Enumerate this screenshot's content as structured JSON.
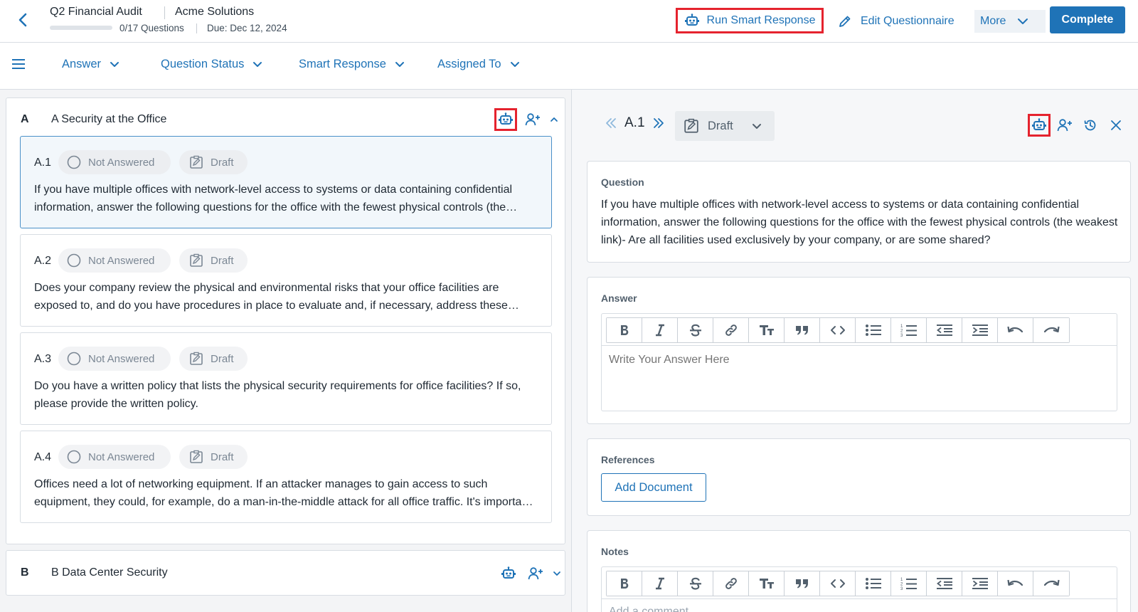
{
  "header": {
    "title": "Q2 Financial Audit",
    "company": "Acme Solutions",
    "questions_progress": "0/17 Questions",
    "progress_fraction": 0,
    "due": "Due: Dec 12, 2024",
    "run_smart_response": "Run Smart Response",
    "edit_questionnaire": "Edit Questionnaire",
    "more": "More",
    "complete": "Complete"
  },
  "filters": [
    {
      "label": "Answer"
    },
    {
      "label": "Question Status"
    },
    {
      "label": "Smart Response"
    },
    {
      "label": "Assigned To"
    }
  ],
  "section_a": {
    "letter": "A",
    "title": "A Security at the Office",
    "questions": [
      {
        "num": "A.1",
        "answer_status": "Not Answered",
        "status": "Draft",
        "text": "If you have multiple offices with network-level access to systems or data containing confidential information, answer the following questions for the office with the fewest physical controls (the weakest link)- Are all facilities used exclusively by your company, or are some shared?"
      },
      {
        "num": "A.2",
        "answer_status": "Not Answered",
        "status": "Draft",
        "text": "Does your company review the physical and environmental risks that your office facilities are exposed to, and do you have procedures in place to evaluate and, if necessary, address these risks?"
      },
      {
        "num": "A.3",
        "answer_status": "Not Answered",
        "status": "Draft",
        "text": "Do you have a written policy that lists the physical security requirements for office facilities? If so, please provide the written policy."
      },
      {
        "num": "A.4",
        "answer_status": "Not Answered",
        "status": "Draft",
        "text": "Offices need a lot of networking equipment. If an attacker manages to gain access to such equipment, they could, for example, do a man-in-the-middle attack for all office traffic. It's important to keep this equipment secure."
      }
    ]
  },
  "section_b": {
    "letter": "B",
    "title": "B Data Center Security"
  },
  "detail": {
    "question_num": "A.1",
    "status": "Draft",
    "question_label": "Question",
    "question_text": "If you have multiple offices with network-level access to systems or data containing confidential information, answer the following questions for the office with the fewest physical controls (the weakest link)- Are all facilities used exclusively by your company, or are some shared?",
    "answer_label": "Answer",
    "answer_placeholder": "Write Your Answer Here",
    "references_label": "References",
    "add_document": "Add Document",
    "notes_label": "Notes",
    "notes_placeholder": "Add a comment"
  },
  "icons": {
    "back": "chevron-left-icon",
    "robot": "robot-icon",
    "pencil": "pencil-icon",
    "menu": "hamburger-menu-icon",
    "assign": "add-user-icon",
    "history": "history-icon",
    "close": "close-icon"
  },
  "colors": {
    "primary": "#1f73b7",
    "highlight": "#e5232e",
    "active_card": "#f2f7fb"
  }
}
